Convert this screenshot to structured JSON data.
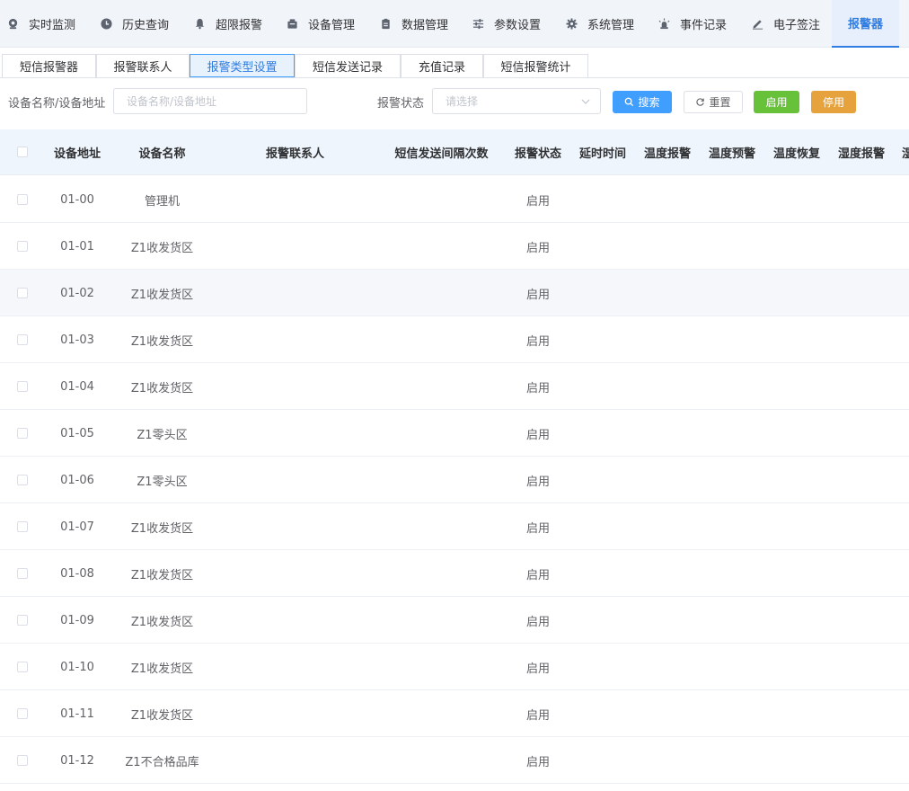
{
  "nav": {
    "items": [
      {
        "label": "实时监测",
        "icon": "location-icon"
      },
      {
        "label": "历史查询",
        "icon": "clock-icon"
      },
      {
        "label": "超限报警",
        "icon": "bell-icon"
      },
      {
        "label": "设备管理",
        "icon": "device-icon"
      },
      {
        "label": "数据管理",
        "icon": "clipboard-icon"
      },
      {
        "label": "参数设置",
        "icon": "sliders-icon"
      },
      {
        "label": "系统管理",
        "icon": "gear-icon"
      },
      {
        "label": "事件记录",
        "icon": "alarm-light-icon"
      },
      {
        "label": "电子签注",
        "icon": "pen-icon"
      }
    ],
    "active_label": "报警器"
  },
  "subtabs": [
    "短信报警器",
    "报警联系人",
    "报警类型设置",
    "短信发送记录",
    "充值记录",
    "短信报警统计"
  ],
  "filters": {
    "device_label": "设备名称/设备地址",
    "device_placeholder": "设备名称/设备地址",
    "status_label": "报警状态",
    "status_placeholder": "请选择"
  },
  "buttons": {
    "search": "搜索",
    "reset": "重置",
    "enable": "启用",
    "disable": "停用"
  },
  "table": {
    "columns": [
      "设备地址",
      "设备名称",
      "报警联系人",
      "短信发送间隔次数",
      "报警状态",
      "延时时间",
      "温度报警",
      "温度预警",
      "温度恢复",
      "湿度报警",
      "湿"
    ],
    "rows": [
      {
        "address": "01-00",
        "name": "管理机",
        "status": "启用"
      },
      {
        "address": "01-01",
        "name": "Z1收发货区",
        "status": "启用"
      },
      {
        "address": "01-02",
        "name": "Z1收发货区",
        "status": "启用"
      },
      {
        "address": "01-03",
        "name": "Z1收发货区",
        "status": "启用"
      },
      {
        "address": "01-04",
        "name": "Z1收发货区",
        "status": "启用"
      },
      {
        "address": "01-05",
        "name": "Z1零头区",
        "status": "启用"
      },
      {
        "address": "01-06",
        "name": "Z1零头区",
        "status": "启用"
      },
      {
        "address": "01-07",
        "name": "Z1收发货区",
        "status": "启用"
      },
      {
        "address": "01-08",
        "name": "Z1收发货区",
        "status": "启用"
      },
      {
        "address": "01-09",
        "name": "Z1收发货区",
        "status": "启用"
      },
      {
        "address": "01-10",
        "name": "Z1收发货区",
        "status": "启用"
      },
      {
        "address": "01-11",
        "name": "Z1收发货区",
        "status": "启用"
      },
      {
        "address": "01-12",
        "name": "Z1不合格品库",
        "status": "启用"
      }
    ]
  },
  "colors": {
    "accent": "#409eff",
    "success": "#67c23a",
    "warning": "#e6a23c",
    "header_bg": "#eef5fd"
  }
}
